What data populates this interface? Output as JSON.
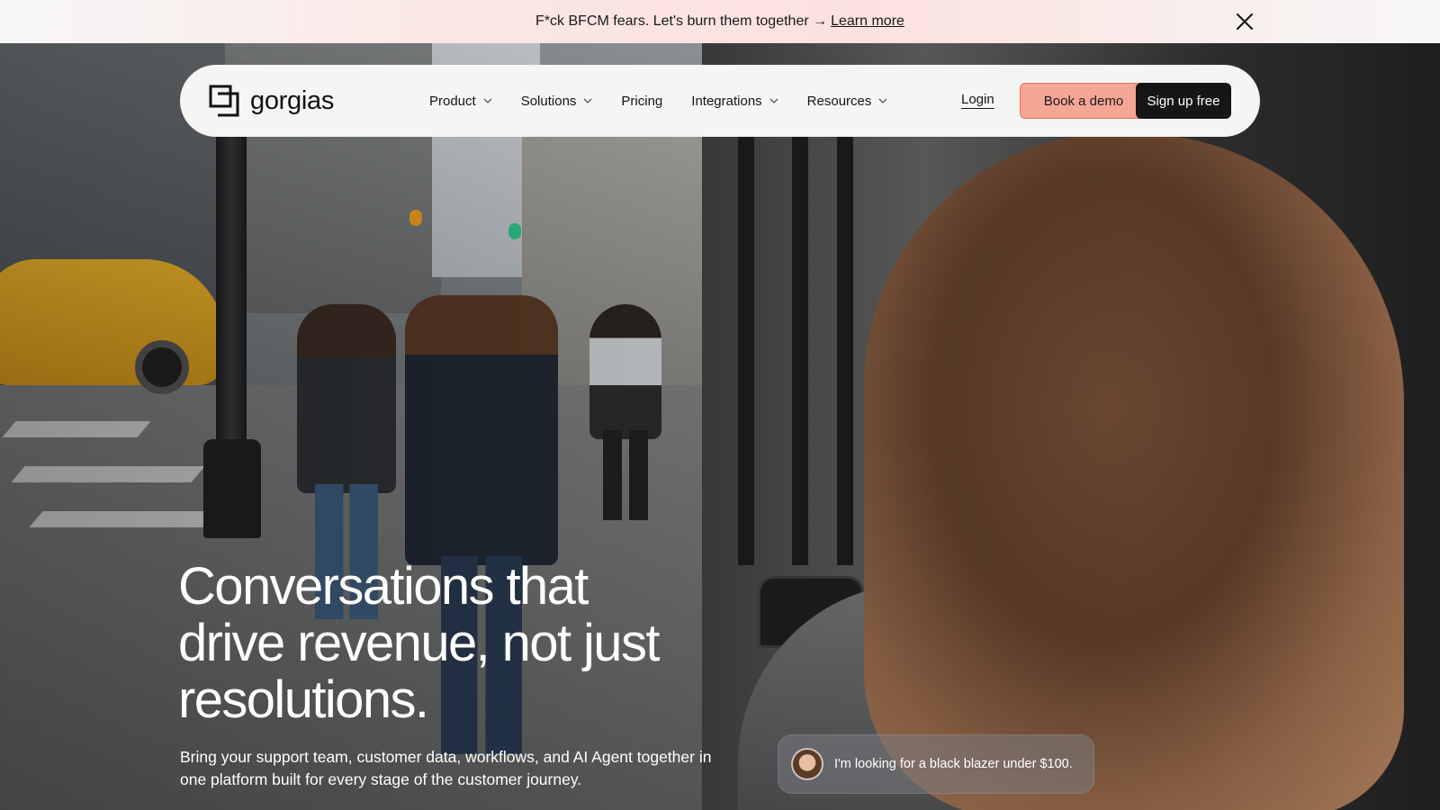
{
  "announcement": {
    "text": "F*ck BFCM fears. Let's burn them together →",
    "link": "Learn more",
    "close_icon": "close-icon"
  },
  "nav": {
    "logo_text": "gorgias",
    "items": [
      {
        "label": "Product",
        "has_dropdown": true
      },
      {
        "label": "Solutions",
        "has_dropdown": true
      },
      {
        "label": "Pricing",
        "has_dropdown": false
      },
      {
        "label": "Integrations",
        "has_dropdown": true
      },
      {
        "label": "Resources",
        "has_dropdown": true
      }
    ],
    "login": "Login",
    "book_demo": "Book a demo",
    "sign_up": "Sign up free"
  },
  "hero": {
    "headline_lines": [
      "Conversations that",
      "drive revenue, not just",
      "resolutions."
    ],
    "subtext": "Bring your support team, customer data, workflows, and AI Agent together in one platform built for every stage of the customer journey."
  },
  "chat": {
    "message": "I'm looking for a black blazer under $100."
  },
  "colors": {
    "demo_button": "#f5a695",
    "signup_button": "#161616",
    "nav_bg": "#f5f5f4"
  }
}
